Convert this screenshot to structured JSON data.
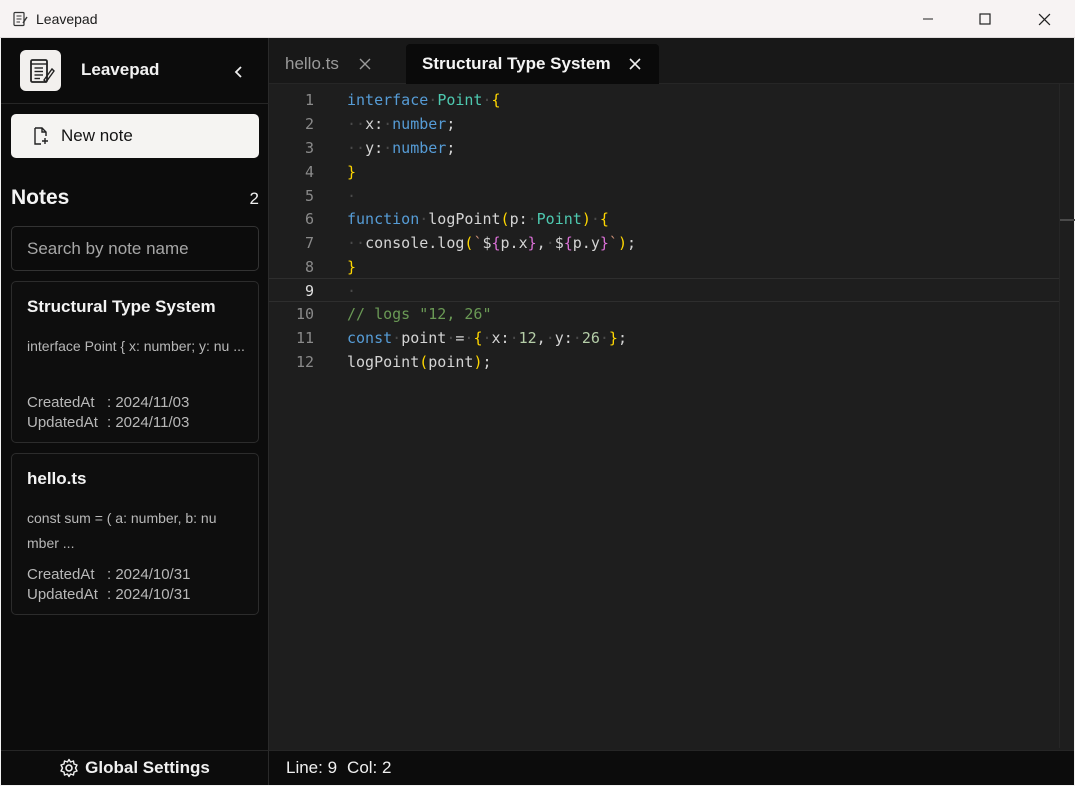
{
  "window": {
    "title": "Leavepad",
    "icon": "notepad-icon",
    "controls": [
      "minimize-icon",
      "maximize-icon",
      "close-icon"
    ]
  },
  "sidebar": {
    "app_name": "Leavepad",
    "new_note_label": "New note",
    "notes_heading": "Notes",
    "notes_count": "2",
    "search_placeholder": "Search by note name",
    "notes": [
      {
        "title": "Structural Type System",
        "preview": "interface Point { x: number; y: nu ...",
        "created_label": "CreatedAt",
        "created": ": 2024/11/03",
        "updated_label": "UpdatedAt",
        "updated": ": 2024/11/03"
      },
      {
        "title": "hello.ts",
        "preview": "const sum = ( a: number, b: nu mber ...",
        "created_label": "CreatedAt",
        "created": ": 2024/10/31",
        "updated_label": "UpdatedAt",
        "updated": ": 2024/10/31"
      }
    ],
    "settings_label": "Global Settings"
  },
  "tabs": [
    {
      "label": "hello.ts",
      "active": false
    },
    {
      "label": "Structural Type System",
      "active": true
    }
  ],
  "editor": {
    "current_line": 9,
    "lines": [
      "interface Point {",
      "  x: number;",
      "  y: number;",
      "}",
      "",
      "function logPoint(p: Point) {",
      "  console.log(`${p.x}, ${p.y}`);",
      "}",
      "",
      "// logs \"12, 26\"",
      "const point = { x: 12, y: 26 };",
      "logPoint(point);"
    ]
  },
  "status": {
    "line": "Line: 9",
    "col": "Col: 2"
  },
  "colors": {
    "accent": "#f5f4f2",
    "keyword": "#569cd6",
    "type": "#4ec9b0",
    "comment": "#6a9955"
  }
}
